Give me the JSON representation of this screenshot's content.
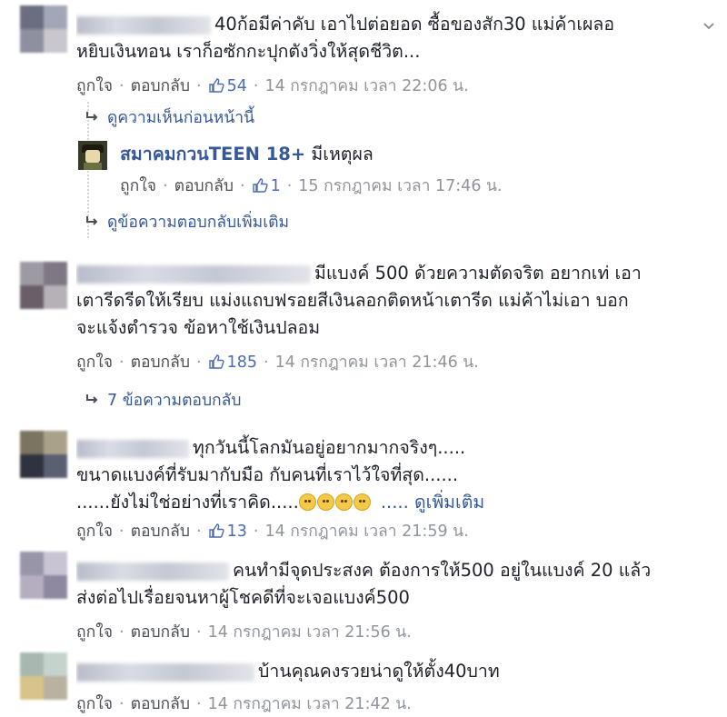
{
  "ui": {
    "like": "ถูกใจ",
    "reply": "ตอบกลับ",
    "dot": "·"
  },
  "comments": [
    {
      "lines": [
        "40ก้อมีค่าคับ เอาไปต่อยอด ซื้อของสัก30 แม่ค้าเผลอ",
        "หยิบเงินทอน เราก็อซักกะปุกตังวิ่งให้สุดชีวิต..."
      ],
      "likes": "54",
      "time": "14 กรกฎาคม เวลา 22:06 น."
    },
    {
      "lines": [
        "มีแบงค์ 500 ด้วยความตัดจริต อยากเท่ เอา",
        "เตารีดรีดให้เรียบ แม่งแถบฟรอยสีเงินลอกติดหน้าเตารีด แม่ค้าไม่เอา บอก",
        "จะแจ้งตำรวจ ข้อหาใช้เงินปลอม"
      ],
      "likes": "185",
      "time": "14 กรกฎาคม เวลา 21:46 น."
    },
    {
      "lines": [
        "ทุกวันนี้โลกมันอยู่อยากมากจริงๆ.....",
        "ขนาดแบงค์ที่รับมากับมือ กับคนที่เราไว้ใจที่สุด......",
        "......ยังไม่ใช่อย่างที่เราคิด....."
      ],
      "more": "..... ดูเพิ่มเติม",
      "likes": "13",
      "time": "14 กรกฎาคม เวลา 21:59 น."
    },
    {
      "lines": [
        "คนทำมีจุดประสงค ต้องการให้500 อยู่ในแบงค์ 20 แล้ว",
        "ส่งต่อไปเรื่อยจนหาผู้โชคดีที่จะเจอแบงค์500"
      ],
      "time": "14 กรกฎาคม เวลา 21:56 น."
    },
    {
      "lines": [
        "บ้านคุณคงรวยน่าดูให้ตั้ง40บาท"
      ],
      "time": "14 กรกฎาคม เวลา 21:42 น."
    }
  ],
  "thread1": {
    "previous_link": "ดูความเห็นก่อนหน้านี้",
    "reply_author": "สมาคมกวนTEEN 18+",
    "reply_text": "มีเหตุผล",
    "reply_likes": "1",
    "reply_time": "15 กรกฎาคม เวลา 17:46 น.",
    "more_replies_link": "ดูข้อความตอบกลับเพิ่มเติม"
  },
  "thread2": {
    "replies_link": "7 ข้อความตอบกลับ"
  },
  "colors": {
    "link": "#365899",
    "meta": "#90949c",
    "text": "#1d2129"
  },
  "icons": [
    "thumbs-up-icon",
    "reply-arrow-icon",
    "chevron-down-icon",
    "emoji-icon"
  ]
}
